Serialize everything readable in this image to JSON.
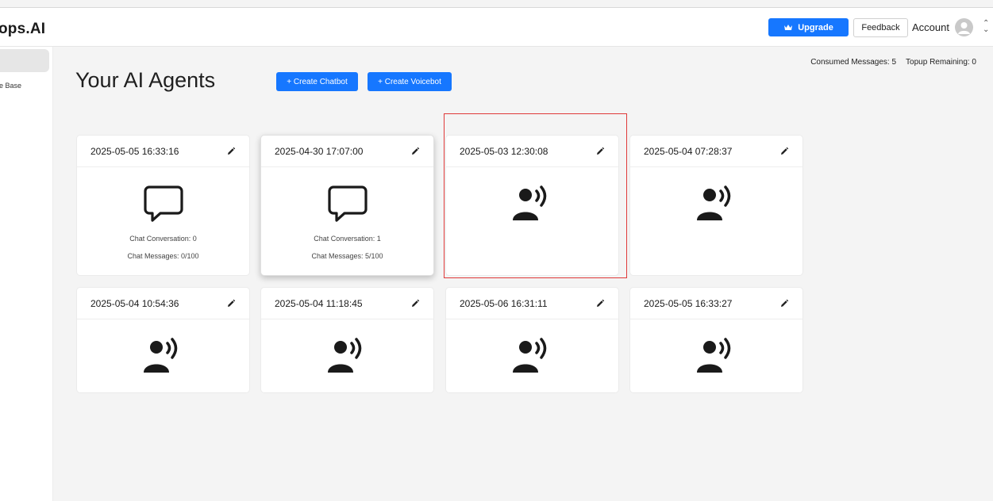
{
  "header": {
    "logo": "ops.AI",
    "upgrade_label": "Upgrade",
    "feedback_label": "Feedback",
    "account_label": "Account"
  },
  "sidebar": {
    "items": [
      {
        "label": ""
      },
      {
        "label": "ge Base"
      }
    ]
  },
  "stats": {
    "consumed": "Consumed Messages: 5",
    "topup": "Topup Remaining: 0"
  },
  "main": {
    "title": "Your AI Agents",
    "create_chatbot_label": "+ Create Chatbot",
    "create_voicebot_label": "+ Create Voicebot"
  },
  "agents": [
    {
      "title": "2025-05-05 16:33:16",
      "type": "chatbot",
      "conversation": "Chat Conversation: 0",
      "messages": "Chat Messages: 0/100"
    },
    {
      "title": "2025-04-30 17:07:00",
      "type": "chatbot",
      "conversation": "Chat Conversation: 1",
      "messages": "Chat Messages: 5/100"
    },
    {
      "title": "2025-05-03 12:30:08",
      "type": "voicebot"
    },
    {
      "title": "2025-05-04 07:28:37",
      "type": "voicebot"
    },
    {
      "title": "2025-05-04 10:54:36",
      "type": "voicebot"
    },
    {
      "title": "2025-05-04 11:18:45",
      "type": "voicebot"
    },
    {
      "title": "2025-05-06 16:31:11",
      "type": "voicebot"
    },
    {
      "title": "2025-05-05 16:33:27",
      "type": "voicebot"
    }
  ],
  "colors": {
    "primary": "#1677ff",
    "selection": "#e03a3a",
    "background": "#f4f4f4"
  }
}
